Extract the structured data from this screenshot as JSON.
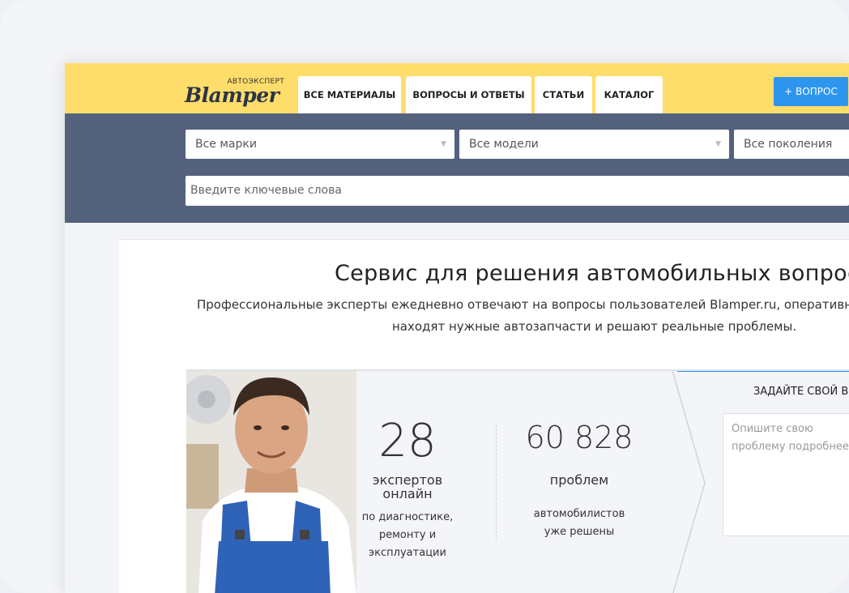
{
  "header": {
    "logo_sub": "АВТОЭКСПЕРТ",
    "logo_main": "Blamper",
    "tabs": [
      "ВСЕ МАТЕРИАЛЫ",
      "ВОПРОСЫ И ОТВЕТЫ",
      "СТАТЬИ",
      "КАТАЛОГ"
    ],
    "ask_button": "+ ВОПРОС"
  },
  "filters": {
    "brand": "Все марки",
    "model": "Все модели",
    "generation": "Все поколения",
    "search_placeholder": "Введите ключевые слова"
  },
  "intro": {
    "title": "Сервис для решения автомобильных вопросов",
    "line1": "Профессиональные эксперты ежедневно отвечают на вопросы пользователей Blamper.ru, оперативно",
    "line2": "находят нужные автозапчасти и решают реальные проблемы."
  },
  "stats": {
    "experts_count": "28",
    "experts_label": "экспертов онлайн",
    "experts_desc": "по диагностике, ремонту и эксплуатации",
    "problems_count": "60 828",
    "problems_label": "проблем",
    "problems_desc": "автомобилистов уже решены"
  },
  "ask_form": {
    "title": "ЗАДАЙТЕ СВОЙ ВОПРОС",
    "placeholder": "Опишите свою проблему подробнее"
  },
  "colors": {
    "header_bg": "#fedd6b",
    "filter_bg": "#54627e",
    "accent": "#2e95ef"
  }
}
